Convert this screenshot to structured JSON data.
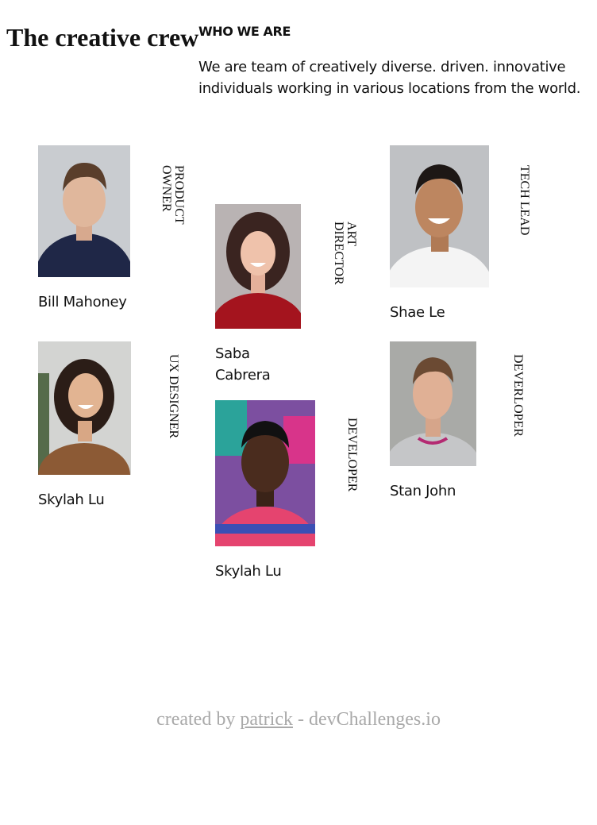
{
  "page": {
    "title": "The creative crew",
    "intro_heading": "WHO WE ARE",
    "intro_text": "We are team of creatively diverse. driven. innovative individuals working in various locations from the world."
  },
  "members": [
    {
      "name": "Bill Mahoney",
      "role": "PRODUCT\nOWNER",
      "photo": "portrait-photo"
    },
    {
      "name": "Saba\nCabrera",
      "role": "ART\nDIRECTOR",
      "photo": "portrait-photo"
    },
    {
      "name": "Shae Le",
      "role": "TECH LEAD",
      "photo": "portrait-photo"
    },
    {
      "name": "Skylah Lu",
      "role": "UX DESIGNER",
      "photo": "portrait-photo"
    },
    {
      "name": "Skylah Lu",
      "role": "DEVELOPER",
      "photo": "portrait-photo"
    },
    {
      "name": "Stan John",
      "role": "DEVERLOPER",
      "photo": "portrait-photo"
    }
  ],
  "footer": {
    "prefix": "created by ",
    "link": "patrick",
    "suffix": " - devChallenges.io"
  },
  "colors": {
    "text": "#111111",
    "footer_text": "#a9a9a9"
  }
}
